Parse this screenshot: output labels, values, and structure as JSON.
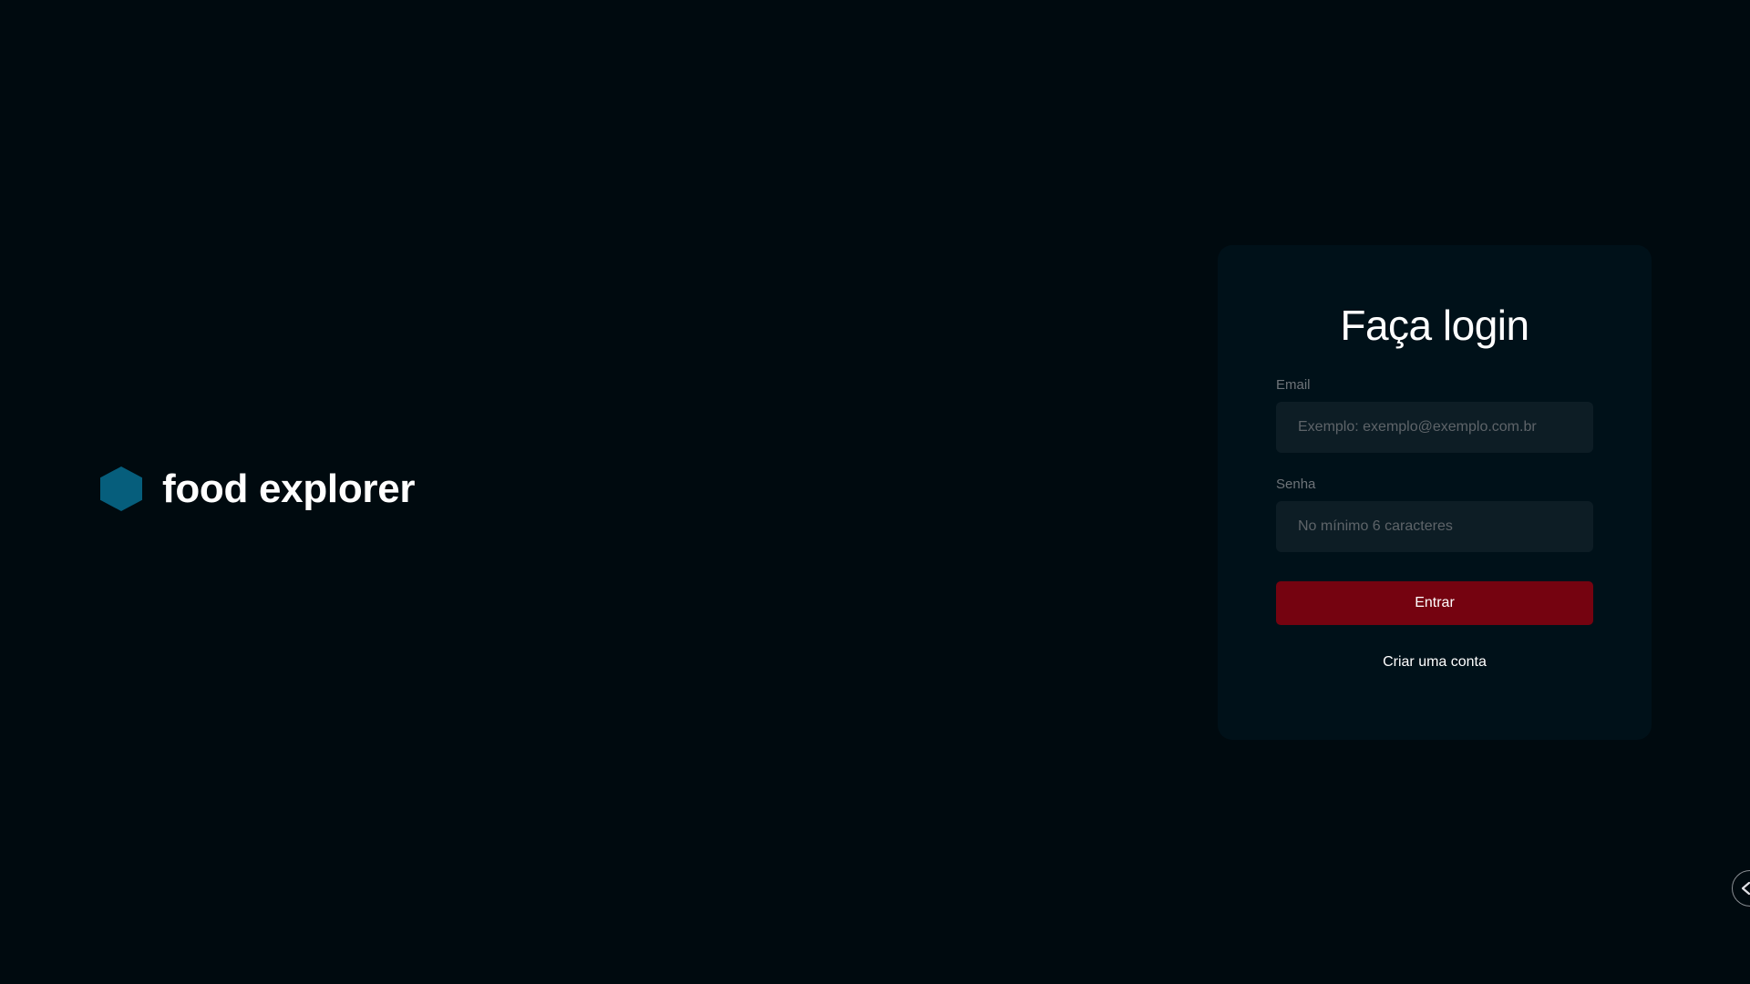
{
  "brand": {
    "name": "food explorer",
    "icon": "hexagon-icon",
    "icon_color": "#065e7c"
  },
  "login": {
    "title": "Faça login",
    "email": {
      "label": "Email",
      "placeholder": "Exemplo: exemplo@exemplo.com.br",
      "value": ""
    },
    "password": {
      "label": "Senha",
      "placeholder": "No mínimo 6 caracteres",
      "value": ""
    },
    "submit_label": "Entrar",
    "signup_link": "Criar uma conta"
  },
  "edge_handle": {
    "icon": "chevron-left-icon"
  },
  "colors": {
    "background": "#000a0f",
    "card_background": "#001119",
    "input_background": "#0d1d25",
    "button": "#750310"
  }
}
